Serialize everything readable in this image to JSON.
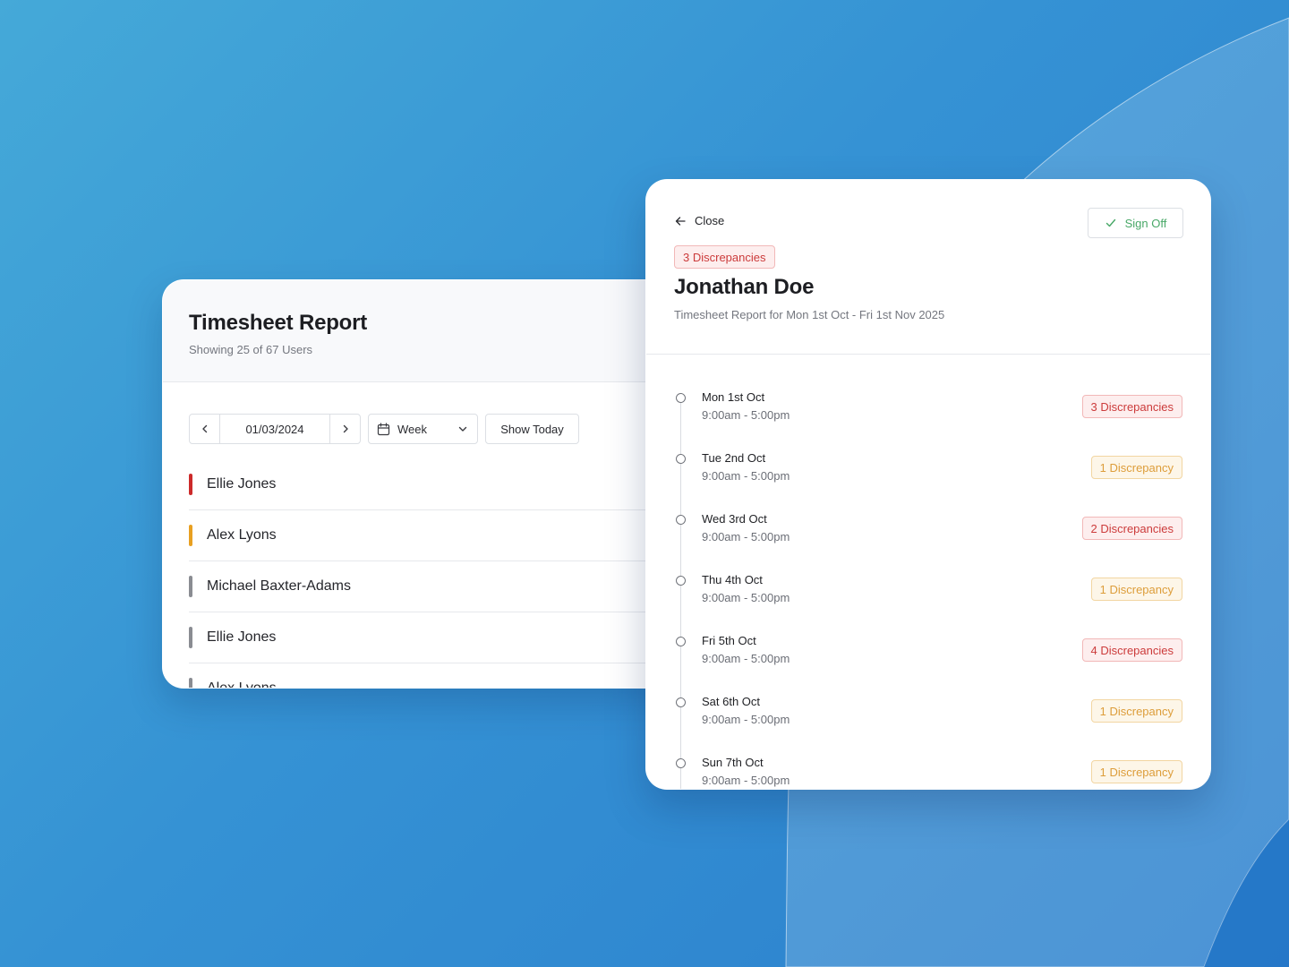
{
  "colors": {
    "background": "#3592d4",
    "danger": "#cc3b3b",
    "warning": "#dd9d3a",
    "success": "#48a867"
  },
  "report": {
    "title": "Timesheet Report",
    "subtitle": "Showing 25 of 67 Users",
    "controls": {
      "prev_icon": "chevron-left-icon",
      "date": "01/03/2024",
      "next_icon": "chevron-right-icon",
      "period_icon": "calendar-icon",
      "period": "Week",
      "period_dropdown_icon": "chevron-down-icon",
      "today_label": "Show Today"
    },
    "users": [
      {
        "name": "Ellie Jones",
        "status_color": "#cc2a2a"
      },
      {
        "name": "Alex Lyons",
        "status_color": "#e8a021"
      },
      {
        "name": "Michael Baxter-Adams",
        "status_color": "#8a8c92"
      },
      {
        "name": "Ellie Jones",
        "status_color": "#8a8c92"
      },
      {
        "name": "Alex Lyons",
        "status_color": "#8a8c92"
      }
    ]
  },
  "detail": {
    "close_icon": "arrow-left-icon",
    "close_label": "Close",
    "signoff_icon": "check-icon",
    "signoff_label": "Sign Off",
    "discrepancy_badge": "3 Discrepancies",
    "employee_name": "Jonathan Doe",
    "period_text": "Timesheet Report for Mon 1st Oct - Fri 1st Nov 2025",
    "days": [
      {
        "label": "Mon 1st Oct",
        "hours": "9:00am - 5:00pm",
        "badge": "3 Discrepancies",
        "severity": "red"
      },
      {
        "label": "Tue 2nd Oct",
        "hours": "9:00am - 5:00pm",
        "badge": "1 Discrepancy",
        "severity": "amber"
      },
      {
        "label": "Wed 3rd Oct",
        "hours": "9:00am - 5:00pm",
        "badge": "2 Discrepancies",
        "severity": "red"
      },
      {
        "label": "Thu 4th Oct",
        "hours": "9:00am - 5:00pm",
        "badge": "1 Discrepancy",
        "severity": "amber"
      },
      {
        "label": "Fri 5th Oct",
        "hours": "9:00am - 5:00pm",
        "badge": "4 Discrepancies",
        "severity": "red"
      },
      {
        "label": "Sat 6th Oct",
        "hours": "9:00am - 5:00pm",
        "badge": "1 Discrepancy",
        "severity": "amber"
      },
      {
        "label": "Sun 7th Oct",
        "hours": "9:00am - 5:00pm",
        "badge": "1 Discrepancy",
        "severity": "amber"
      }
    ]
  }
}
